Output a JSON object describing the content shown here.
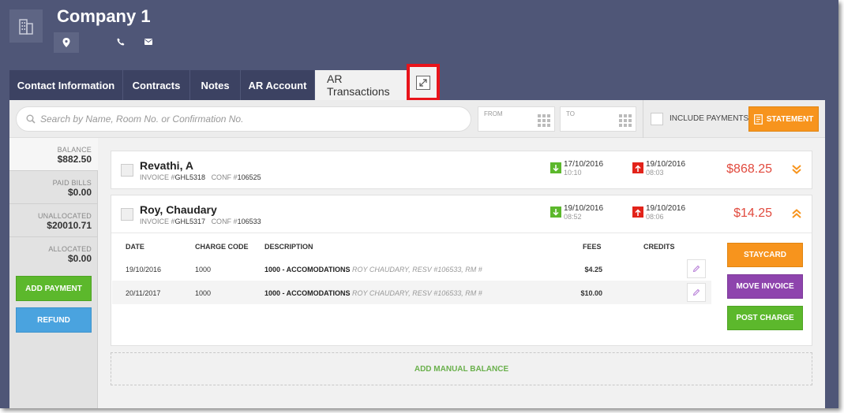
{
  "header": {
    "company_name": "Company 1"
  },
  "tabs": [
    {
      "label": "Contact Information"
    },
    {
      "label": "Contracts"
    },
    {
      "label": "Notes"
    },
    {
      "label": "AR Account"
    },
    {
      "label": "AR Transactions",
      "active": true
    }
  ],
  "toolbar": {
    "search_placeholder": "Search by Name, Room No. or Confirmation No.",
    "from_label": "FROM",
    "to_label": "TO",
    "include_payments_label": "INCLUDE PAYMENTS",
    "statement_label": "STATEMENT"
  },
  "sidebar": {
    "balance_label": "BALANCE",
    "balance_value": "$882.50",
    "paid_bills_label": "PAID BILLS",
    "paid_bills_value": "$0.00",
    "unallocated_label": "UNALLOCATED",
    "unallocated_value": "$20010.71",
    "allocated_label": "ALLOCATED",
    "allocated_value": "$0.00",
    "add_payment_label": "ADD PAYMENT",
    "refund_label": "REFUND"
  },
  "invoices": [
    {
      "name": "Revathi, A",
      "invoice_prefix": "INVOICE #",
      "invoice_no": "GHL5318",
      "conf_prefix": "CONF #",
      "conf_no": "106525",
      "arrival_date": "17/10/2016",
      "arrival_time": "10:10",
      "departure_date": "19/10/2016",
      "departure_time": "08:03",
      "amount": "$868.25"
    },
    {
      "name": "Roy, Chaudary",
      "invoice_prefix": "INVOICE #",
      "invoice_no": "GHL5317",
      "conf_prefix": "CONF #",
      "conf_no": "106533",
      "arrival_date": "19/10/2016",
      "arrival_time": "08:52",
      "departure_date": "19/10/2016",
      "departure_time": "08:06",
      "amount": "$14.25"
    }
  ],
  "detail": {
    "columns": {
      "date": "DATE",
      "charge_code": "CHARGE CODE",
      "description": "DESCRIPTION",
      "fees": "FEES",
      "credits": "CREDITS"
    },
    "rows": [
      {
        "date": "19/10/2016",
        "charge_code": "1000",
        "desc_main": "1000 - ACCOMODATIONS",
        "desc_detail": "ROY CHAUDARY, RESV #106533, RM #",
        "fees": "$4.25"
      },
      {
        "date": "20/11/2017",
        "charge_code": "1000",
        "desc_main": "1000 - ACCOMODATIONS",
        "desc_detail": "ROY CHAUDARY, RESV #106533, RM #",
        "fees": "$10.00"
      }
    ],
    "staycard_label": "STAYCARD",
    "move_invoice_label": "MOVE INVOICE",
    "post_charge_label": "POST CHARGE"
  },
  "add_manual_balance_label": "ADD MANUAL BALANCE",
  "colors": {
    "header_bg": "#4f5677",
    "tab_bg": "#3c4262",
    "accent_orange": "#f7941d",
    "green": "#5cb82c",
    "purple": "#8e44ad",
    "blue": "#4aa3df",
    "amount_red": "#e14a3e",
    "highlight_red": "#e8141b"
  },
  "icons": [
    "building-icon",
    "location-pin-icon",
    "phone-icon",
    "mail-icon",
    "expand-icon",
    "search-icon",
    "calendar-icon",
    "statement-icon",
    "arrival-arrow-icon",
    "departure-arrow-icon",
    "chevron-down-icon",
    "chevron-up-icon",
    "pencil-icon"
  ]
}
